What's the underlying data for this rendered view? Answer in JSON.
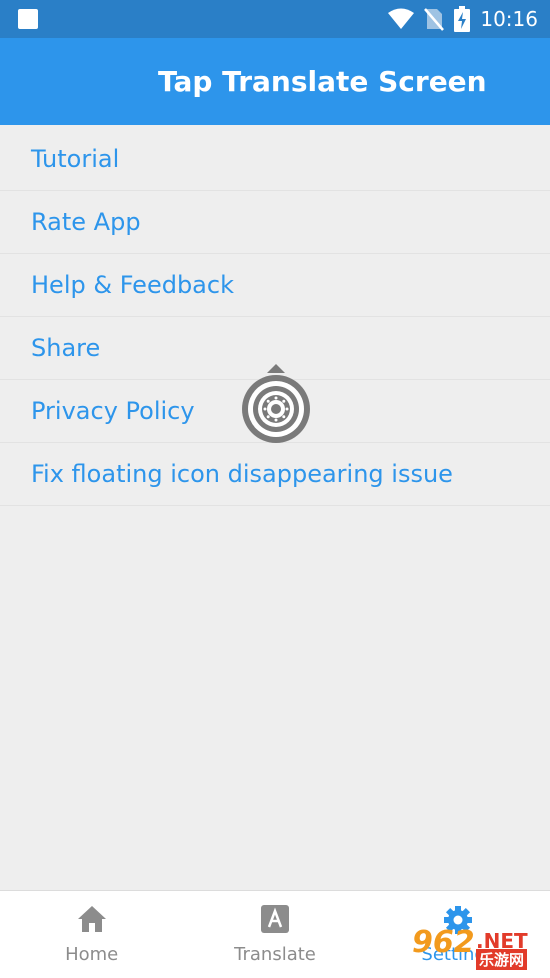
{
  "status_bar": {
    "time": "10:16",
    "icons": [
      "notification-square-icon",
      "wifi-icon",
      "no-sim-icon",
      "battery-charging-icon"
    ]
  },
  "app_bar": {
    "title": "Tap Translate Screen"
  },
  "menu": {
    "items": [
      {
        "label": "Tutorial"
      },
      {
        "label": "Rate App"
      },
      {
        "label": "Help & Feedback"
      },
      {
        "label": "Share"
      },
      {
        "label": "Privacy Policy"
      },
      {
        "label": "Fix floating icon disappearing issue"
      }
    ]
  },
  "bottom_nav": {
    "items": [
      {
        "label": "Home",
        "icon": "home-icon"
      },
      {
        "label": "Translate",
        "icon": "translate-icon"
      },
      {
        "label": "Settings",
        "icon": "gear-icon",
        "active": true
      }
    ]
  },
  "watermark": {
    "number": "962",
    "suffix": ".NET",
    "cn_text": "乐游网"
  },
  "colors": {
    "status_bar": "#2a7fc7",
    "primary": "#2d95eb",
    "background": "#eeeeee",
    "nav_inactive": "#8c8c8c"
  }
}
